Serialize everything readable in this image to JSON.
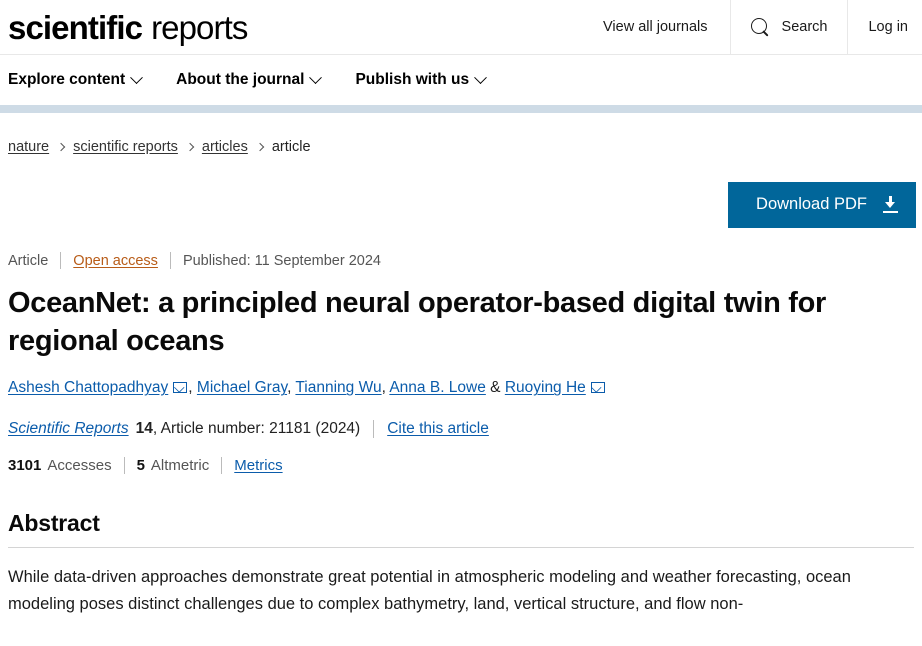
{
  "header": {
    "brand_bold": "scientific",
    "brand_regular": "reports",
    "view_all_journals": "View all journals",
    "search_label": "Search",
    "login_label": "Log in"
  },
  "nav": {
    "items": [
      {
        "label": "Explore content"
      },
      {
        "label": "About the journal"
      },
      {
        "label": "Publish with us"
      }
    ]
  },
  "breadcrumb": {
    "items": [
      {
        "label": "nature",
        "link": true
      },
      {
        "label": "scientific reports",
        "link": true
      },
      {
        "label": "articles",
        "link": true
      },
      {
        "label": "article",
        "link": false
      }
    ]
  },
  "actions": {
    "download_pdf": "Download PDF"
  },
  "article": {
    "type": "Article",
    "access": "Open access",
    "published": "Published: 11 September 2024",
    "title": "OceanNet: a principled neural operator-based digital twin for regional oceans",
    "authors": [
      {
        "name": "Ashesh Chattopadhyay",
        "corresponding": true,
        "after": ", "
      },
      {
        "name": "Michael Gray",
        "corresponding": false,
        "after": ", "
      },
      {
        "name": "Tianning Wu",
        "corresponding": false,
        "after": ", "
      },
      {
        "name": "Anna B. Lowe",
        "corresponding": false,
        "after": " & "
      },
      {
        "name": "Ruoying He",
        "corresponding": true,
        "after": ""
      }
    ],
    "journal": "Scientific Reports",
    "volume": "14",
    "article_number_text": ", Article number: 21181 (2024)",
    "cite_label": "Cite this article",
    "metrics": {
      "accesses_count": "3101",
      "accesses_label": "Accesses",
      "altmetric_count": "5",
      "altmetric_label": "Altmetric",
      "metrics_link": "Metrics"
    },
    "abstract_heading": "Abstract",
    "abstract_text": "While data-driven approaches demonstrate great potential in atmospheric modeling and weather forecasting, ocean modeling poses distinct challenges due to complex bathymetry, land, vertical structure, and flow non-"
  },
  "colors": {
    "brand_blue": "#01669a",
    "link_blue": "#0b5cab",
    "open_access_orange": "#b85c18",
    "stripe": "#cedbe6"
  }
}
